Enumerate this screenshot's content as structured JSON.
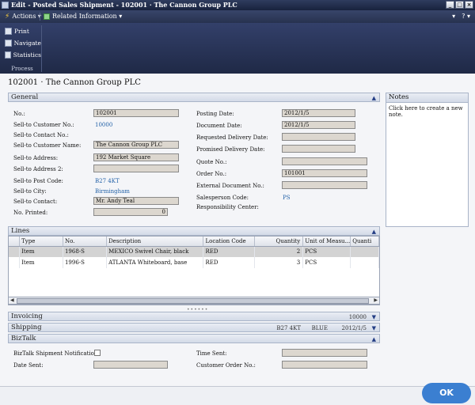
{
  "window": {
    "title": "Edit - Posted Sales Shipment - 102001 · The Cannon Group PLC",
    "controls": [
      "_",
      "□",
      "×"
    ]
  },
  "menu": {
    "actions": "Actions ▾",
    "related": "Related Information ▾",
    "right_icons": [
      "▾",
      "? ▾"
    ]
  },
  "ribbon": {
    "buttons": [
      "Print",
      "Navigate",
      "Statistics"
    ],
    "group": "Process"
  },
  "page_title": "102001 · The Cannon Group PLC",
  "general": {
    "header": "General",
    "left": {
      "no_label": "No.:",
      "no_value": "102001",
      "customer_no_label": "Sell-to Customer No.:",
      "customer_no_value": "10000",
      "contact_no_label": "Sell-to Contact No.:",
      "customer_name_label": "Sell-to Customer Name:",
      "customer_name_value": "The Cannon Group PLC",
      "address_label": "Sell-to Address:",
      "address_value": "192 Market Square",
      "address2_label": "Sell-to Address 2:",
      "address2_value": "",
      "post_code_label": "Sell-to Post Code:",
      "post_code_value": "B27 4KT",
      "city_label": "Sell-to City:",
      "city_value": "Birmingham",
      "contact_label": "Sell-to Contact:",
      "contact_value": "Mr. Andy Teal",
      "printed_label": "No. Printed:",
      "printed_value": "0"
    },
    "right": {
      "posting_date_label": "Posting Date:",
      "posting_date_value": "2012/1/5",
      "document_date_label": "Document Date:",
      "document_date_value": "2012/1/5",
      "req_delivery_label": "Requested Delivery Date:",
      "req_delivery_value": "",
      "prom_delivery_label": "Promised Delivery Date:",
      "prom_delivery_value": "",
      "quote_no_label": "Quote No.:",
      "quote_no_value": "",
      "order_no_label": "Order No.:",
      "order_no_value": "101001",
      "ext_doc_label": "External Document No.:",
      "ext_doc_value": "",
      "salesperson_label": "Salesperson Code:",
      "salesperson_value": "PS",
      "resp_center_label": "Responsibility Center:"
    }
  },
  "notes": {
    "header": "Notes",
    "hint": "Click here to create a new note."
  },
  "lines": {
    "header": "Lines",
    "columns": [
      "Type",
      "No.",
      "Description",
      "Location Code",
      "Quantity",
      "Unit of Measu...",
      "Quanti"
    ],
    "rows": [
      [
        "Item",
        "1968-S",
        "MEXICO Swivel Chair, black",
        "RED",
        "2",
        "PCS",
        ""
      ],
      [
        "Item",
        "1996-S",
        "ATLANTA Whiteboard, base",
        "RED",
        "3",
        "PCS",
        ""
      ]
    ]
  },
  "invoicing": {
    "header": "Invoicing",
    "summary": "10000"
  },
  "shipping": {
    "header": "Shipping",
    "summary": [
      "B27 4KT",
      "BLUE",
      "2012/1/5"
    ]
  },
  "biztalk": {
    "header": "BizTalk",
    "notification_label": "BizTalk Shipment Notification:",
    "date_sent_label": "Date Sent:",
    "date_sent_value": "",
    "time_sent_label": "Time Sent:",
    "time_sent_value": "",
    "customer_order_label": "Customer Order No.:",
    "customer_order_value": ""
  },
  "ok": "OK"
}
